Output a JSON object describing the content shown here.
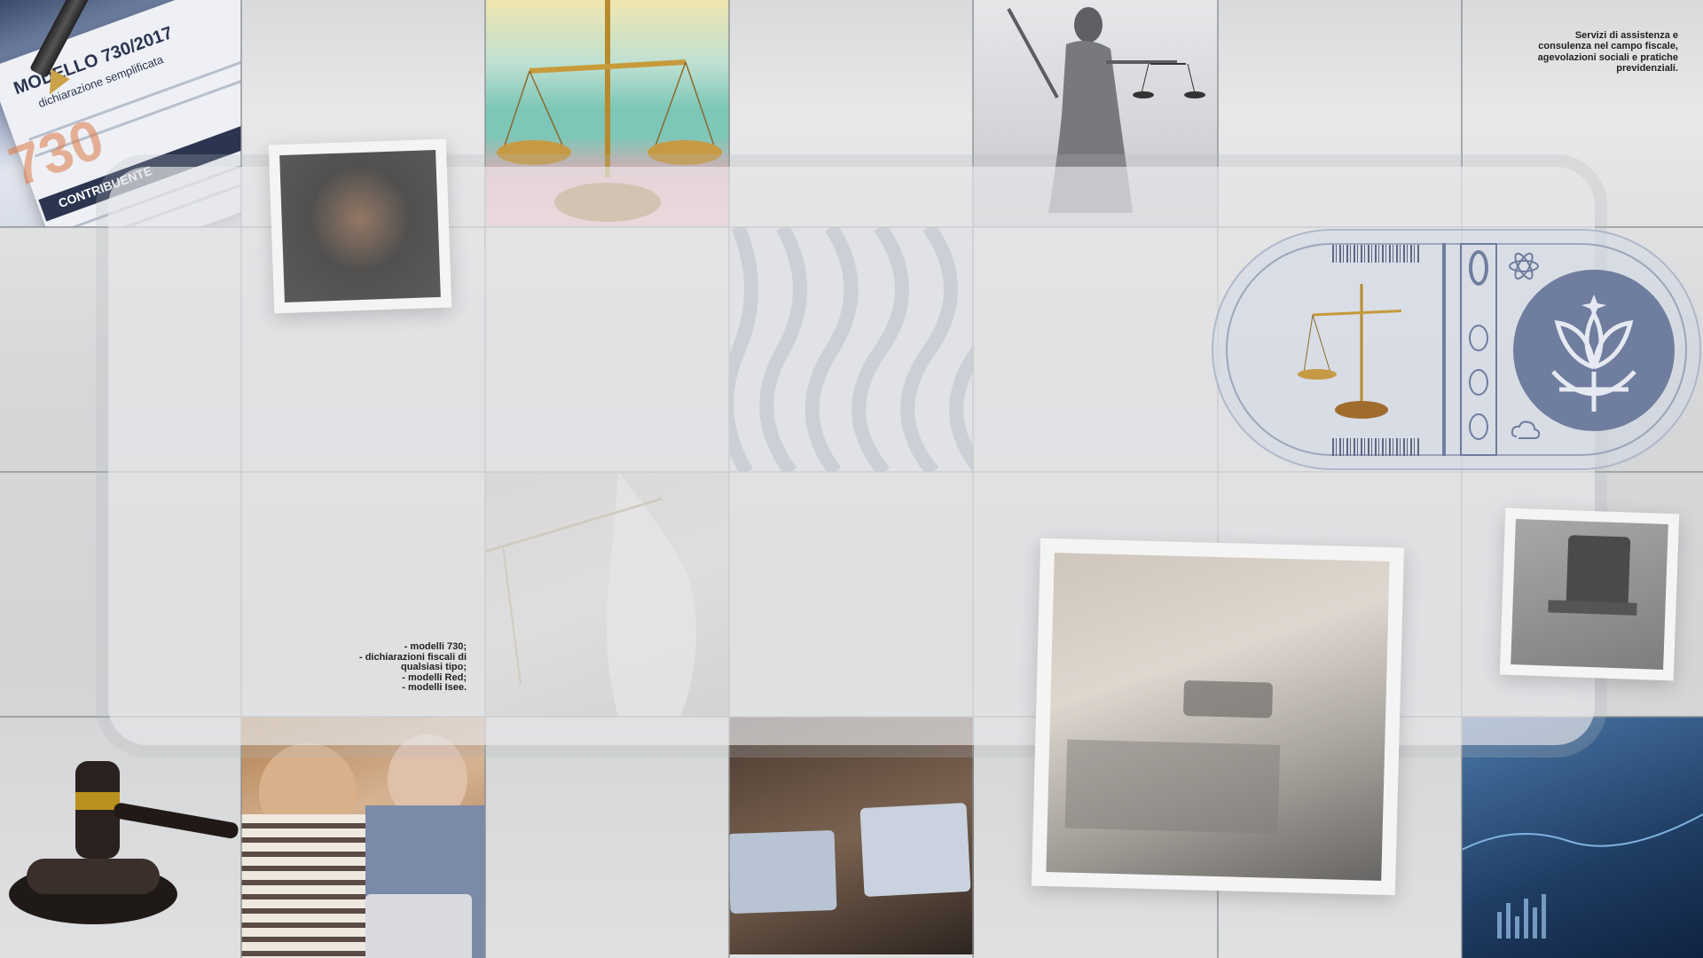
{
  "header_text": {
    "tagline": "Servizi di assistenza e consulenza nel campo fiscale, agevolazioni sociali e pratiche previdenziali."
  },
  "services_list": {
    "items": [
      "- modelli 730;",
      "- dichiarazioni fiscali di",
      "qualsiasi tipo;",
      "- modelli Red;",
      "- modelli Isee."
    ]
  },
  "form_tile": {
    "heading": "MODELLO 730/2017",
    "subheading": "dichiarazione semplificata",
    "band_label": "CONTRIBUENTE"
  },
  "colors": {
    "background": "#d9dadc",
    "grid_line": "#8c8e92",
    "logo_accent": "#6f7d9e",
    "text": "#222222"
  },
  "icons": [
    "scales-icon",
    "gavel-icon",
    "lady-justice-icon",
    "plant-globe-logo-icon",
    "barcode-icon",
    "atom-icon"
  ]
}
